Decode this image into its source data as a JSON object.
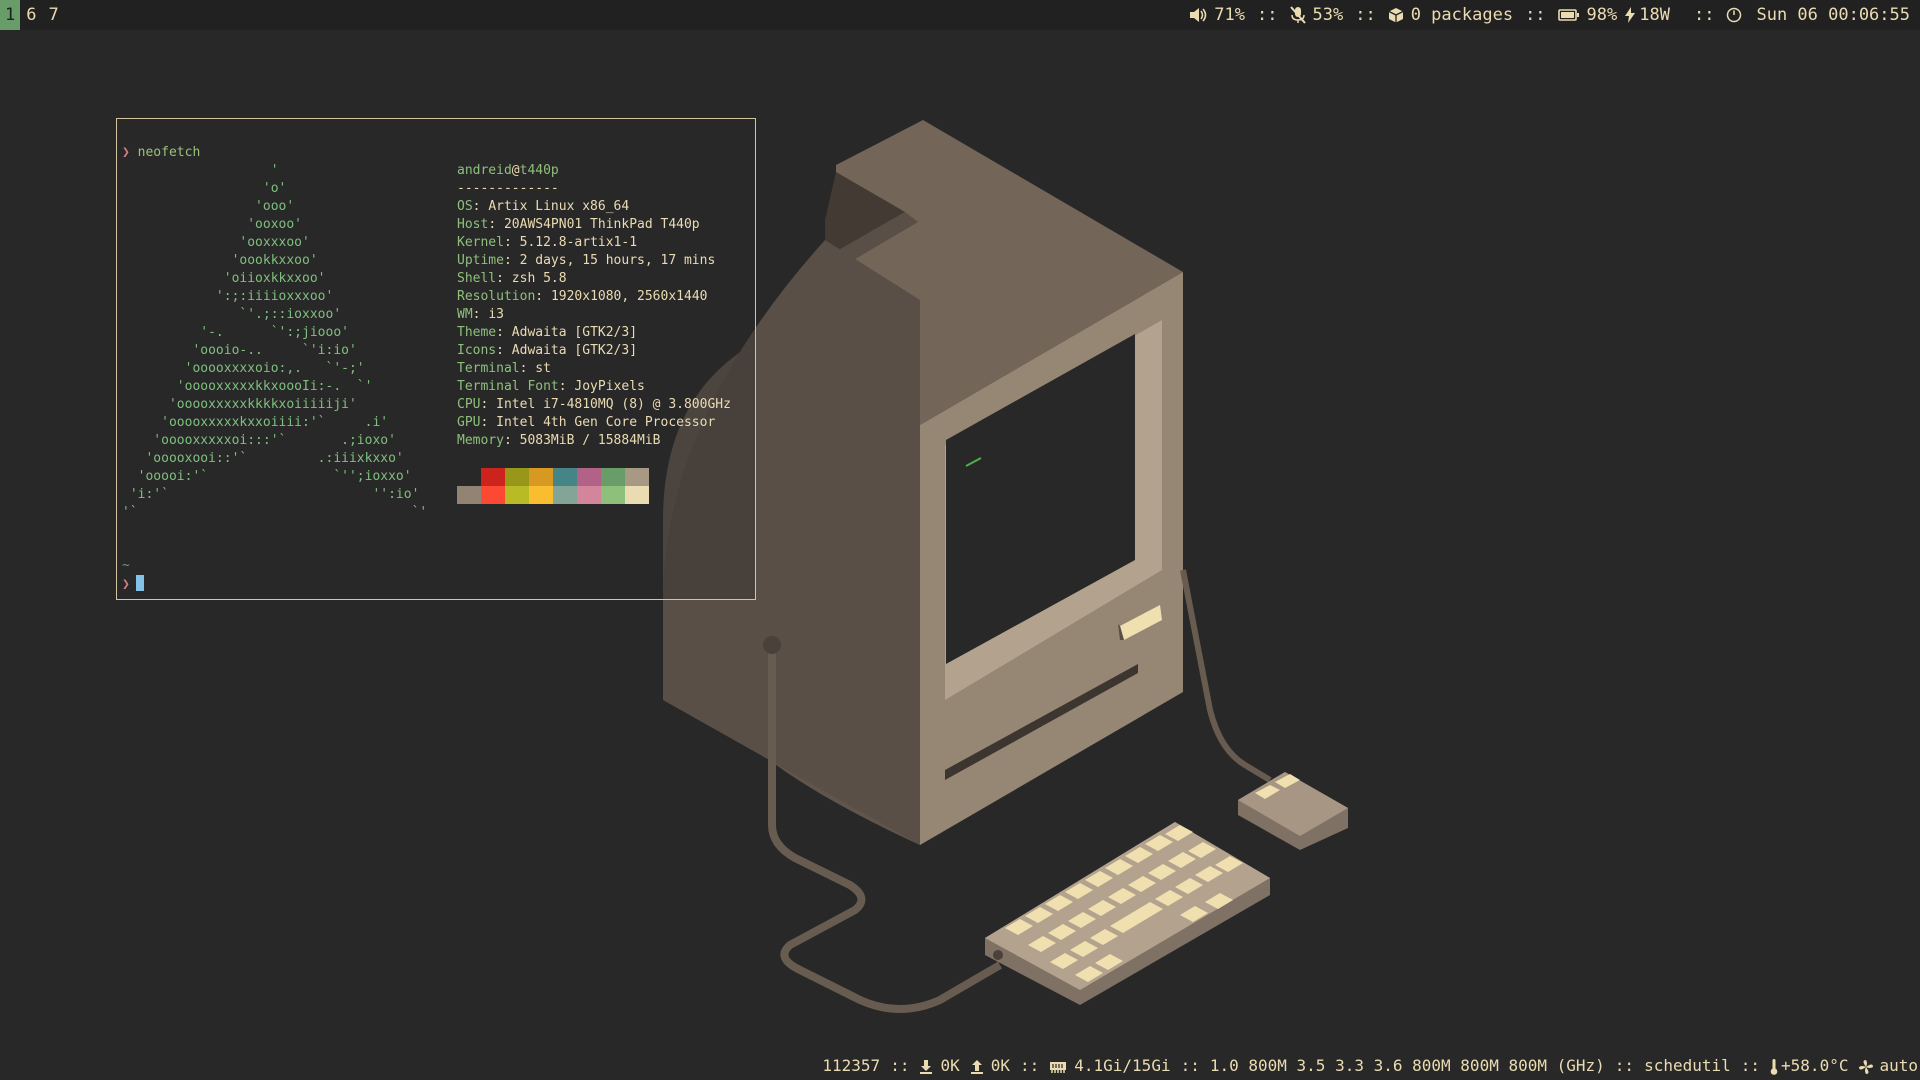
{
  "topbar": {
    "workspaces": [
      "1",
      "6",
      "7"
    ],
    "active_workspace": "1",
    "volume": "71%",
    "mic": "53%",
    "packages": "0 packages",
    "battery": "98%",
    "power": "18W",
    "datetime": "Sun 06 00:06:55",
    "separator": "::"
  },
  "bottombar": {
    "count": "112357",
    "download": "0K",
    "upload": "0K",
    "memory": "4.1Gi/15Gi",
    "cpu_freqs": "1.0 800M 3.5 3.3 3.6 800M 800M 800M (GHz)",
    "governor": "schedutil",
    "temperature": "+58.0°C",
    "fan": "auto",
    "separator": "::"
  },
  "terminal": {
    "prompt_symbol": "❯",
    "command": "neofetch",
    "ascii_art": "                   '\n                  'o'\n                 'ooo'\n                'ooxoo'\n               'ooxxxoo'\n              'oookkxxoo'\n             'oiioxkkxxoo'\n            ':;:iiiioxxxoo'\n               `'.;::ioxxoo'\n          '-.      `':;jiooo'\n         'oooio-..     `'i:io'\n        'ooooxxxxoio:,.   `'-;'\n       'ooooxxxxxkkxoooIi:-.  `'\n      'ooooxxxxxkkkkxoiiiiiji'\n     'ooooxxxxxkxxoiiii:'`     .i'\n    'ooooxxxxxoi:::'`       .;ioxo'\n   'ooooxooi::'`         .:iiixkxxo'\n  'ooooi:'`                `'';ioxxo'\n 'i:'`                          '':io'\n'`                                   `'",
    "user": "andreid",
    "at": "@",
    "host": "t440p",
    "dashes": "-------------",
    "info": [
      {
        "key": "OS",
        "value": "Artix Linux x86_64"
      },
      {
        "key": "Host",
        "value": "20AWS4PN01 ThinkPad T440p"
      },
      {
        "key": "Kernel",
        "value": "5.12.8-artix1-1"
      },
      {
        "key": "Uptime",
        "value": "2 days, 15 hours, 17 mins"
      },
      {
        "key": "Shell",
        "value": "zsh 5.8"
      },
      {
        "key": "Resolution",
        "value": "1920x1080, 2560x1440"
      },
      {
        "key": "WM",
        "value": "i3"
      },
      {
        "key": "Theme",
        "value": "Adwaita [GTK2/3]"
      },
      {
        "key": "Icons",
        "value": "Adwaita [GTK2/3]"
      },
      {
        "key": "Terminal",
        "value": "st"
      },
      {
        "key": "Terminal Font",
        "value": "JoyPixels"
      },
      {
        "key": "CPU",
        "value": "Intel i7-4810MQ (8) @ 3.800GHz"
      },
      {
        "key": "GPU",
        "value": "Intel 4th Gen Core Processor"
      },
      {
        "key": "Memory",
        "value": "5083MiB / 15884MiB"
      }
    ],
    "palette_top": [
      "#282828",
      "#cc241d",
      "#98971a",
      "#d79921",
      "#458588",
      "#b16286",
      "#689d6a",
      "#a89984"
    ],
    "palette_bottom": [
      "#928374",
      "#fb4934",
      "#b8bb26",
      "#fabd2f",
      "#83a598",
      "#d3869b",
      "#8ec07c",
      "#ebdbb2"
    ],
    "tilde": "~"
  },
  "colors": {
    "background": "#282828",
    "bar_background": "#212121",
    "active_workspace": "#689d6a",
    "accent_green": "#8ec07c",
    "cursor": "#83c3e8"
  }
}
